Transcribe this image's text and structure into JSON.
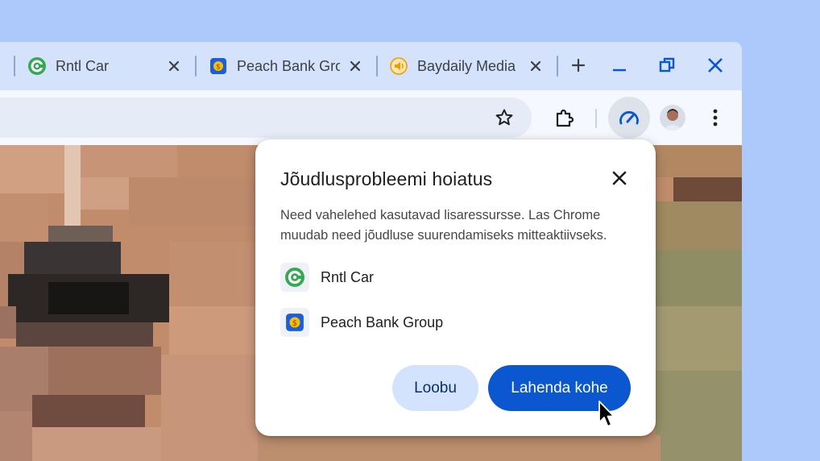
{
  "tabs": [
    {
      "title": "Rntl Car",
      "icon": "rntl-car-logo-icon"
    },
    {
      "title": "Peach Bank Group",
      "icon": "peach-bank-logo-icon"
    },
    {
      "title": "Baydaily Media",
      "icon": "baydaily-media-logo-icon"
    }
  ],
  "toolbar": {
    "icons": [
      "bookmark-star-icon",
      "extensions-puzzle-icon",
      "performance-gauge-icon",
      "profile-avatar",
      "more-vert-icon"
    ]
  },
  "dialog": {
    "title": "Jõudlusprobleemi hoiatus",
    "body": "Need vahelehed kasutavad lisaressursse. Las Chrome muudab need jõudluse suurendamiseks mitteaktiivseks.",
    "sites": [
      {
        "name": "Rntl Car",
        "icon": "rntl-car-logo-icon"
      },
      {
        "name": "Peach Bank Group",
        "icon": "peach-bank-logo-icon"
      }
    ],
    "cancel_label": "Loobu",
    "fix_label": "Lahenda kohe"
  },
  "colors": {
    "desktop": "#adc8fa",
    "tabstrip": "#d4e2fb",
    "toolbar": "#f5f8fe",
    "primary_button": "#0b57d0",
    "secondary_button": "#d3e3fd",
    "rntl_green": "#34a853",
    "peach_blue": "#1a5fd9",
    "baydaily_orange": "#f29900"
  }
}
